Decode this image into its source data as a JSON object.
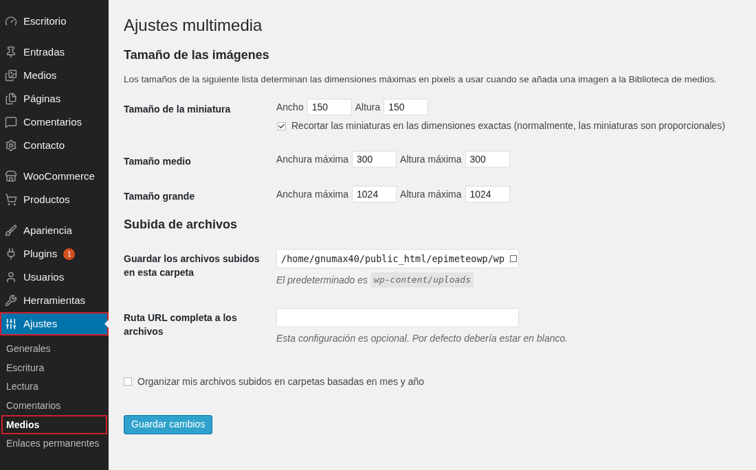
{
  "sidebar": {
    "groups": [
      [
        {
          "label": "Escritorio",
          "selected": false,
          "outlined": false
        }
      ],
      [
        {
          "label": "Entradas",
          "selected": false,
          "outlined": false
        },
        {
          "label": "Medios",
          "selected": false,
          "outlined": false
        },
        {
          "label": "Páginas",
          "selected": false,
          "outlined": false
        },
        {
          "label": "Comentarios",
          "selected": false,
          "outlined": false
        },
        {
          "label": "Contacto",
          "selected": false,
          "outlined": false
        }
      ],
      [
        {
          "label": "WooCommerce",
          "selected": false,
          "outlined": false
        },
        {
          "label": "Productos",
          "selected": false,
          "outlined": false
        }
      ],
      [
        {
          "label": "Apariencia",
          "selected": false,
          "outlined": false
        },
        {
          "label": "Plugins",
          "selected": false,
          "outlined": false,
          "badge": "1"
        },
        {
          "label": "Usuarios",
          "selected": false,
          "outlined": false
        },
        {
          "label": "Herramientas",
          "selected": false,
          "outlined": false
        },
        {
          "label": "Ajustes",
          "selected": true,
          "outlined": true
        }
      ]
    ],
    "submenu": [
      {
        "label": "Generales",
        "selected": false,
        "outlined": false
      },
      {
        "label": "Escritura",
        "selected": false,
        "outlined": false
      },
      {
        "label": "Lectura",
        "selected": false,
        "outlined": false
      },
      {
        "label": "Comentarios",
        "selected": false,
        "outlined": false
      },
      {
        "label": "Medios",
        "selected": true,
        "outlined": true
      },
      {
        "label": "Enlaces permanentes",
        "selected": false,
        "outlined": false
      }
    ]
  },
  "title": "Ajustes multimedia",
  "sections": [
    {
      "heading": "Tamaño de las imágenes",
      "description": "Los tamaños de la siguiente lista determinan las dimensiones máximas en pixels a usar cuando se añada una imagen a la Biblioteca de medios.",
      "rows": [
        {
          "kind": "size",
          "label": "Tamaño de la miniatura",
          "fields": [
            {
              "label": "Ancho",
              "value": "150"
            },
            {
              "label": "Altura",
              "value": "150"
            }
          ],
          "checkbox": {
            "label": "Recortar las miniaturas en las dimensiones exactas (normalmente, las miniaturas son proporcionales)",
            "checked": true
          }
        },
        {
          "kind": "size",
          "label": "Tamaño medio",
          "fields": [
            {
              "label": "Anchura máxima",
              "value": "300"
            },
            {
              "label": "Altura máxima",
              "value": "300"
            }
          ]
        },
        {
          "kind": "size",
          "label": "Tamaño grande",
          "fields": [
            {
              "label": "Anchura máxima",
              "value": "1024"
            },
            {
              "label": "Altura máxima",
              "value": "1024"
            }
          ]
        }
      ]
    },
    {
      "heading": "Subida de archivos",
      "rows": [
        {
          "kind": "path",
          "label": "Guardar los archivos subidos en esta carpeta",
          "value": "/home/gnumax40/public_html/epimeteowp/wp",
          "hint": "El predeterminado es",
          "hint_code": "wp-content/uploads"
        },
        {
          "kind": "path",
          "label": "Ruta URL completa a los archivos",
          "hint": "Esta configuración es opcional. Por defecto debería estar en blanco."
        }
      ]
    }
  ],
  "organize_checkbox": {
    "label": "Organizar mis archivos subidos en carpetas basadas en mes y año",
    "checked": false
  },
  "save_button": "Guardar cambios"
}
